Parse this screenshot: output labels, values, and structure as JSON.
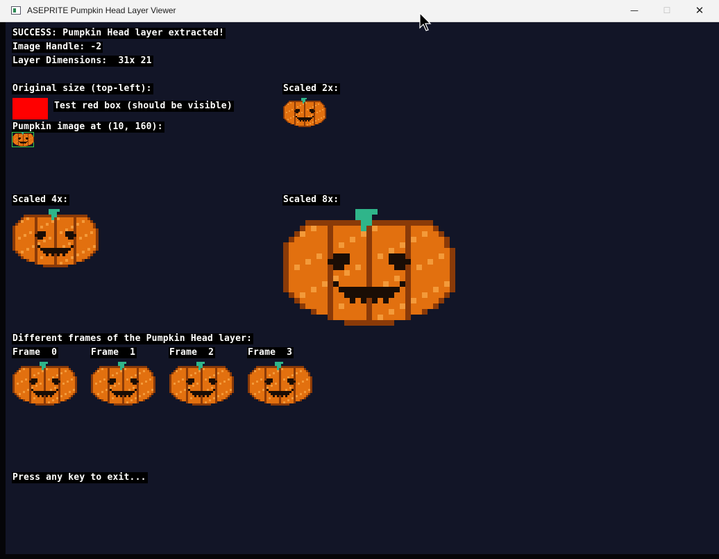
{
  "window": {
    "title": "ASEPRITE Pumpkin Head Layer Viewer",
    "minimize_glyph": "—",
    "maximize_glyph": "☐",
    "close_glyph": "✕"
  },
  "lines": {
    "success": "SUCCESS: Pumpkin Head layer extracted!",
    "handle": "Image Handle: -2",
    "dimensions": "Layer Dimensions:  31x 21",
    "original": "Original size (top-left):",
    "test_box": "Test red box (should be visible)",
    "pumpkin_at": "Pumpkin image at (10, 160):",
    "scaled2": "Scaled 2x:",
    "scaled4": "Scaled 4x:",
    "scaled8": "Scaled 8x:",
    "frames_title": "Different frames of the Pumpkin Head layer:",
    "frame0": "Frame  0",
    "frame1": "Frame  1",
    "frame2": "Frame  2",
    "frame3": "Frame  3",
    "exit": "Press any key to exit..."
  },
  "colors": {
    "background": "#121527",
    "label_bg": "#000000",
    "text": "#ffffff",
    "red_box": "#ff0000",
    "selection": "#36d04a",
    "pumpkin_orange": "#e2700f",
    "pumpkin_dark": "#8a3a08",
    "stem": "#2fb58a"
  },
  "icons": {
    "app": "window-app-icon",
    "cursor": "mouse-pointer-icon"
  }
}
